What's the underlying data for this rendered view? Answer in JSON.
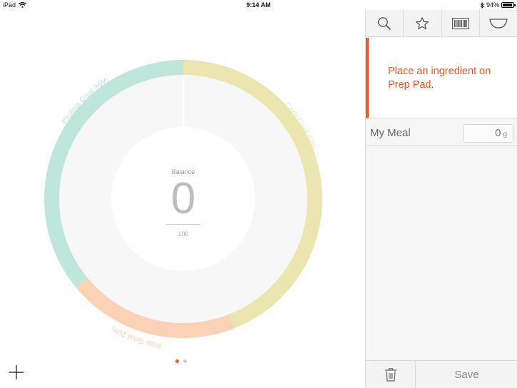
{
  "status_bar": {
    "device": "iPad",
    "time": "9:14 AM",
    "battery": "94%",
    "battery_level": 0.94
  },
  "nutrition_wheel": {
    "balance_label": "Balance",
    "balance_value": "0",
    "balance_goal": "100",
    "segments": [
      {
        "label": "Protein Goal 36%",
        "percent": 36,
        "color": "#bfe6da"
      },
      {
        "label": "Carb Goal 44%",
        "percent": 44,
        "color": "#ebe6b0"
      },
      {
        "label": "Fats Goal 20%",
        "percent": 20,
        "color": "#fbd2b6"
      }
    ]
  },
  "pager": {
    "count": 2,
    "active_index": 0,
    "active_color": "#f05a22",
    "inactive_color": "#cccccc"
  },
  "toolbar": {
    "items": [
      {
        "icon": "search-icon"
      },
      {
        "icon": "star-icon"
      },
      {
        "icon": "barcode-icon"
      },
      {
        "icon": "bowl-icon"
      }
    ]
  },
  "prompt": {
    "text": "Place an ingredient on Prep Pad."
  },
  "meal": {
    "name": "My Meal",
    "weight": "0",
    "unit": "g"
  },
  "bottom": {
    "save_label": "Save"
  },
  "colors": {
    "accent": "#f05a22"
  }
}
